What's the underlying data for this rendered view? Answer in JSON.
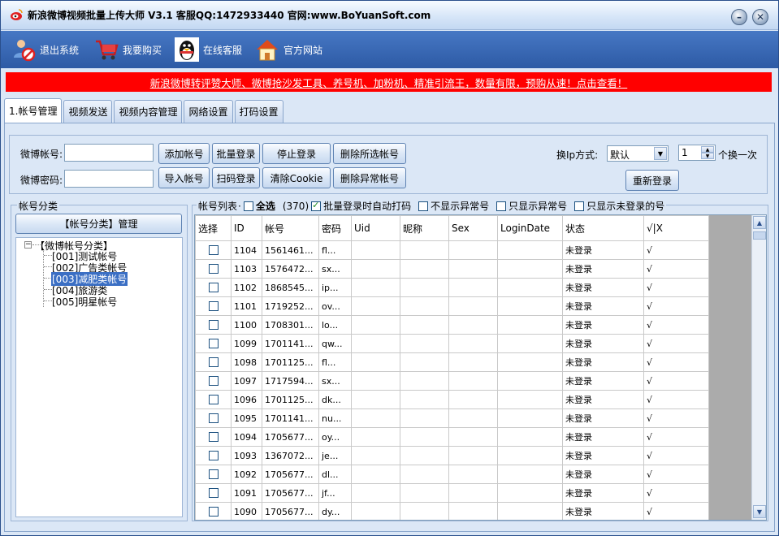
{
  "title": "新浪微博视频批量上传大师 V3.1 客服QQ:1472933440 官网:www.BoYuanSoft.com",
  "toolbar": {
    "logout": "退出系统",
    "buy": "我要购买",
    "support": "在线客服",
    "website": "官方网站"
  },
  "banner": "新浪微博转评赞大师、微博抢沙发工具、养号机、加粉机、精准引流王，数量有限，预购从速！点击查看！",
  "tabs": [
    "1.帐号管理",
    "视频发送",
    "视频内容管理",
    "网络设置",
    "打码设置"
  ],
  "form": {
    "account_label": "微博帐号:",
    "account_value": "",
    "password_label": "微博密码:",
    "password_value": "",
    "buttons": [
      "添加帐号",
      "批量登录",
      "停止登录",
      "删除所选帐号",
      "导入帐号",
      "扫码登录",
      "清除Cookie",
      "删除异常帐号"
    ],
    "ip_label": "换Ip方式:",
    "ip_value": "默认",
    "switch_count": "1",
    "switch_suffix": "个换一次",
    "relogin": "重新登录"
  },
  "left_panel": {
    "title": "帐号分类",
    "manage_button": "【帐号分类】管理",
    "tree_root": "【微博帐号分类】",
    "tree_items": [
      "[001]测试帐号",
      "[002]广告类帐号",
      "[003]减肥类帐号",
      "[004]旅游类",
      "[005]明星帐号"
    ],
    "selected_index": 2
  },
  "list": {
    "title": "帐号列表",
    "select_all": "全选",
    "count": "(370)",
    "option_auto_captcha": "批量登录时自动打码",
    "option_auto_captcha_checked": true,
    "option_hide_abnormal": "不显示异常号",
    "option_only_abnormal": "只显示异常号",
    "option_only_not_logged": "只显示未登录的号",
    "columns": [
      "选择",
      "ID",
      "帐号",
      "密码",
      "Uid",
      "昵称",
      "Sex",
      "LoginDate",
      "状态",
      "√|X"
    ],
    "rows": [
      [
        "1104",
        "1561461...",
        "fl...",
        "未登录",
        "√"
      ],
      [
        "1103",
        "1576472...",
        "sx...",
        "未登录",
        "√"
      ],
      [
        "1102",
        "1868545...",
        "ip...",
        "未登录",
        "√"
      ],
      [
        "1101",
        "1719252...",
        "ov...",
        "未登录",
        "√"
      ],
      [
        "1100",
        "1708301...",
        "lo...",
        "未登录",
        "√"
      ],
      [
        "1099",
        "1701141...",
        "qw...",
        "未登录",
        "√"
      ],
      [
        "1098",
        "1701125...",
        "fl...",
        "未登录",
        "√"
      ],
      [
        "1097",
        "1717594...",
        "sx...",
        "未登录",
        "√"
      ],
      [
        "1096",
        "1701125...",
        "dk...",
        "未登录",
        "√"
      ],
      [
        "1095",
        "1701141...",
        "nu...",
        "未登录",
        "√"
      ],
      [
        "1094",
        "1705677...",
        "oy...",
        "未登录",
        "√"
      ],
      [
        "1093",
        "1367072...",
        "je...",
        "未登录",
        "√"
      ],
      [
        "1092",
        "1705677...",
        "dl...",
        "未登录",
        "√"
      ],
      [
        "1091",
        "1705677...",
        "jf...",
        "未登录",
        "√"
      ],
      [
        "1090",
        "1705677...",
        "dy...",
        "未登录",
        "√"
      ]
    ]
  }
}
